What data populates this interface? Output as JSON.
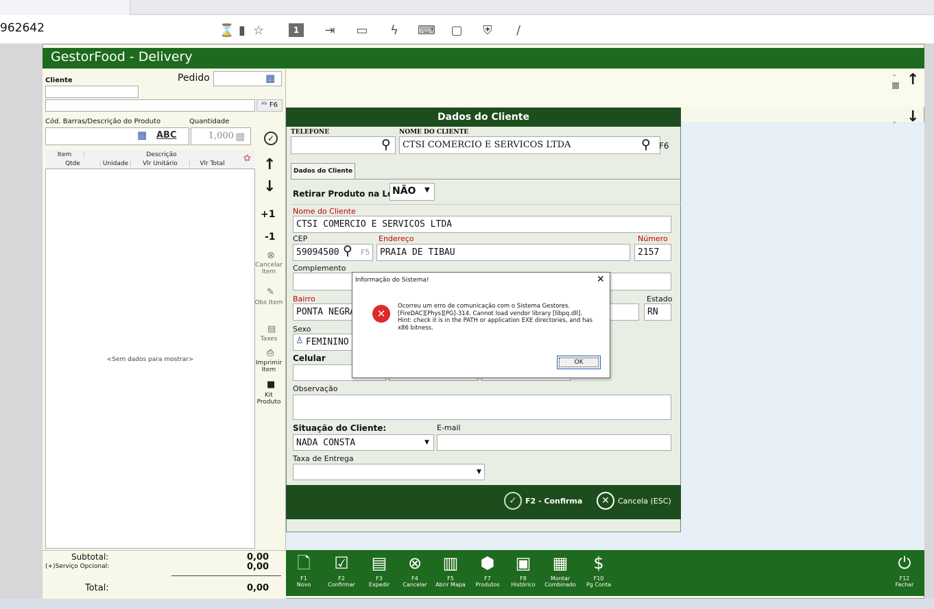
{
  "browser": {
    "address_fragment": "962642"
  },
  "app": {
    "title": "GestorFood - Delivery"
  },
  "order_panel": {
    "cliente_label": "Cliente",
    "pedido_label": "Pedido",
    "f6_label": "F6",
    "cod_label": "Cód. Barras/Descrição  do Produto",
    "quantidade_label": "Quantidade",
    "abc_label": "ABC",
    "quantidade_value": "1,000",
    "grid_headers_row1": [
      "Item",
      "Descrição"
    ],
    "grid_headers_row2": [
      "Qtde",
      "Unidade",
      "Vlr Unitário",
      "Vlr Total"
    ],
    "empty_text": "<Sem dados para mostrar>",
    "plus_one": "+1",
    "minus_one": "-1",
    "cancelar_item": "Cancelar Item",
    "obs_item": "Obs Item",
    "taxes": "Taxes",
    "imprimir_item": "Imprimir Item",
    "kit_produto": "Kit Produto",
    "subtotal_label": "Subtotal:",
    "subtotal_value": "0,00",
    "servico_label": "(+)Serviço Opcional:",
    "servico_value": "0,00",
    "total_label": "Total:",
    "total_value": "0,00"
  },
  "dialog": {
    "title": "Dados do Cliente",
    "telefone_label": "TELEFONE",
    "nome_label": "NOME DO CLIENTE",
    "nome_value": "CTSI COMERCIO E SERVICOS LTDA",
    "f6": "F6",
    "tab_label": "Dados do Cliente",
    "retirar_label": "Retirar Produto na Loja:",
    "retirar_value": "NÃO",
    "nome_cliente_label": "Nome do Cliente",
    "nome_cliente_value": "CTSI COMERCIO E SERVICOS LTDA",
    "cep_label": "CEP",
    "cep_value": "59094500",
    "f5": "F5",
    "endereco_label": "Endereço",
    "endereco_value": "PRAIA DE TIBAU",
    "numero_label": "Número",
    "numero_value": "2157",
    "complemento_label": "Complemento",
    "bairro_label": "Bairro",
    "bairro_value": "PONTA NEGRA",
    "estado_label": "Estado",
    "estado_value": "RN",
    "sexo_label": "Sexo",
    "sexo_value": "FEMININO",
    "celular_label": "Celular",
    "observacao_label": "Observação",
    "situacao_label": "Situação do Cliente:",
    "situacao_value": "NADA CONSTA",
    "email_label": "E-mail",
    "taxa_label": "Taxa de Entrega",
    "confirma_label": "F2 - Confirma",
    "cancela_label": "Cancela (ESC)"
  },
  "message_box": {
    "title": "Informação do Sistema!",
    "text": "Ocorreu um erro de comunicação com o Sistema Gestores. [FireDAC][Phys][PG]-314. Cannot load vendor library [libpq.dll]. Hint: check it is in the PATH or application EXE directories, and has x86 bitness.",
    "ok_label": "OK"
  },
  "bottom_toolbar": [
    {
      "key": "F1",
      "label": "Novo",
      "icon": "new-document-icon"
    },
    {
      "key": "F2",
      "label": "Confirmar",
      "icon": "check-icon"
    },
    {
      "key": "F3",
      "label": "Expedir",
      "icon": "document-icon"
    },
    {
      "key": "F4",
      "label": "Cancelar",
      "icon": "cancel-icon"
    },
    {
      "key": "F5",
      "label": "Abrir Mapa",
      "icon": "map-icon"
    },
    {
      "key": "F7",
      "label": "Produtos",
      "icon": "box-icon"
    },
    {
      "key": "F8",
      "label": "Histórico",
      "icon": "history-icon"
    },
    {
      "key": "",
      "label": "Montar Combinado",
      "icon": "combo-icon"
    },
    {
      "key": "F10",
      "label": "Pg Conta",
      "icon": "money-bag-icon"
    }
  ],
  "fechar": {
    "key": "F12",
    "label": "Fechar"
  },
  "colors": {
    "titlebar_green": "#1e6a1e",
    "dialog_green": "#1d4d1d",
    "required_red": "#c00000",
    "panel_bg": "#f8f8ea"
  }
}
